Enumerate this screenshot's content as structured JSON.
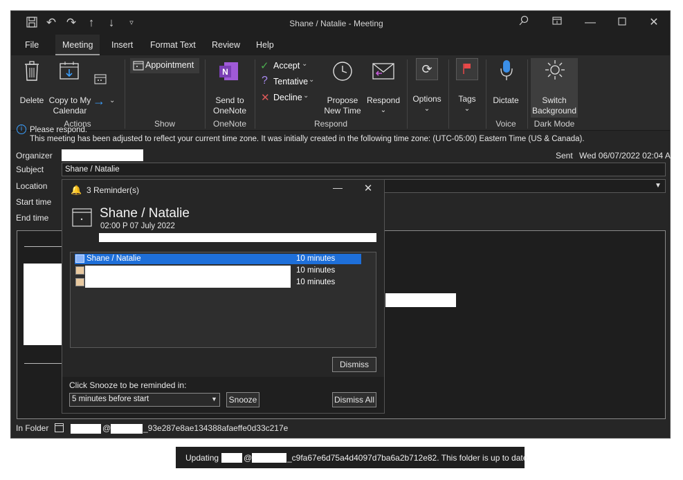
{
  "title_bar": {
    "title": "Shane / Natalie  -  Meeting",
    "quick_access": [
      "save-icon",
      "undo-icon",
      "redo-icon",
      "up-arrow-icon",
      "down-arrow-icon",
      "customize-icon"
    ],
    "window_buttons": [
      "search-icon",
      "ribbon-display-icon",
      "minimize-icon",
      "maximize-icon",
      "close-icon"
    ]
  },
  "tabs": [
    "File",
    "Meeting",
    "Insert",
    "Format Text",
    "Review",
    "Help"
  ],
  "active_tab": "Meeting",
  "ribbon": {
    "actions": {
      "delete": "Delete",
      "copy_line1": "Copy to My",
      "copy_line2": "Calendar",
      "group": "Actions"
    },
    "show": {
      "appointment": "Appointment",
      "group": "Show"
    },
    "onenote": {
      "line1": "Send to",
      "line2": "OneNote",
      "group": "OneNote"
    },
    "respond": {
      "accept": "Accept",
      "tentative": "Tentative",
      "decline": "Decline",
      "propose_line1": "Propose",
      "propose_line2": "New Time",
      "respond": "Respond",
      "group": "Respond"
    },
    "options": {
      "label": "Options"
    },
    "tags": {
      "label": "Tags"
    },
    "voice": {
      "dictate": "Dictate",
      "group": "Voice"
    },
    "dark_mode": {
      "line1": "Switch",
      "line2": "Background",
      "group": "Dark Mode"
    }
  },
  "info_bar": {
    "line1": "Please respond.",
    "line2": "This meeting has been adjusted to reflect your current time zone. It was initially created in the following time zone: (UTC-05:00) Eastern Time (US & Canada)."
  },
  "form": {
    "organizer_label": "Organizer",
    "sent_label": "Sent",
    "sent_value": "Wed 06/07/2022 02:04 A",
    "subject_label": "Subject",
    "subject_value": "Shane / Natalie",
    "location_label": "Location",
    "start_label": "Start time",
    "end_label": "End time",
    "in_folder_label": "In Folder",
    "in_folder_at": "@",
    "in_folder_value": "_93e287e8ae134388afaeffe0d33c217e"
  },
  "reminder": {
    "title": "3 Reminder(s)",
    "subject": "Shane / Natalie",
    "datetime": "02:00 P 07 July 2022",
    "items": [
      {
        "name": "Shane / Natalie",
        "due": "10 minutes",
        "selected": true
      },
      {
        "name": "",
        "due": "10 minutes",
        "selected": false
      },
      {
        "name": "",
        "due": "10 minutes",
        "selected": false
      }
    ],
    "dismiss": "Dismiss",
    "snooze_prompt": "Click Snooze to be reminded in:",
    "snooze_option": "5 minutes before start",
    "snooze": "Snooze",
    "dismiss_all": "Dismiss All"
  },
  "status_bar": {
    "prefix": "Updating",
    "at": "@",
    "suffix": "_c9fa67e6d75a4d4097d7ba6a2b712e82.  This folder is up to date."
  },
  "colors": {
    "selection": "#1e6fd9",
    "accept": "#4caf50",
    "tentative": "#a98bf2",
    "decline": "#e05a5a",
    "bell": "#f2b84b",
    "onenote": "#7b3fb5"
  }
}
